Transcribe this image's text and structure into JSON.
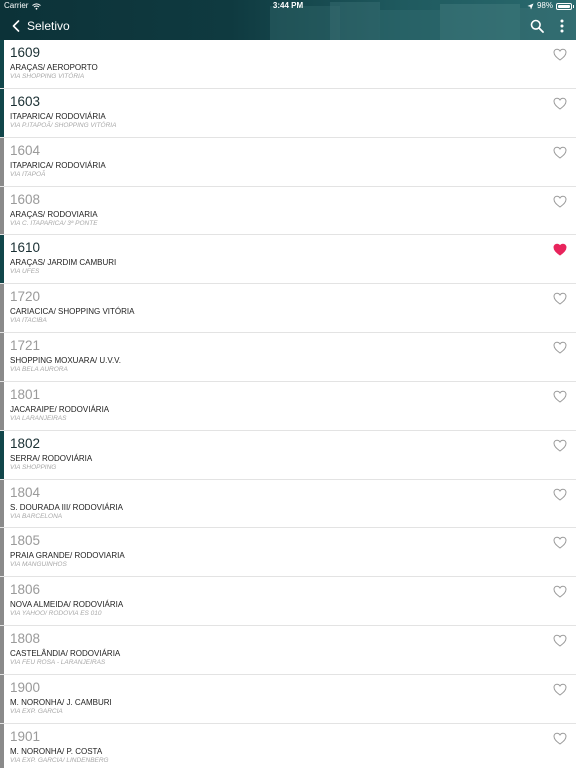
{
  "status_bar": {
    "carrier": "Carrier",
    "time": "3:44 PM",
    "battery": "98%",
    "battery_level": 0.98
  },
  "nav": {
    "title": "Seletivo"
  },
  "colors": {
    "header": "#0f3a40",
    "accent_bar_active": "#11464a",
    "accent_bar_inactive": "#8a8a8a",
    "favorite": "#e8245c",
    "icon_outline": "#9a9a9a"
  },
  "routes": [
    {
      "number": "1609",
      "name": "ARAÇAS/ AEROPORTO",
      "via": "VIA SHOPPING VITÓRIA",
      "active": true,
      "favorite": false
    },
    {
      "number": "1603",
      "name": "ITAPARICA/ RODOVIÁRIA",
      "via": "VIA P.ITAPOÃ/ SHOPPING VITÓRIA",
      "active": true,
      "favorite": false
    },
    {
      "number": "1604",
      "name": "ITAPARICA/ RODOVIÁRIA",
      "via": "VIA ITAPOÃ",
      "active": false,
      "favorite": false
    },
    {
      "number": "1608",
      "name": "ARAÇAS/ RODOVIARIA",
      "via": "VIA C. ITAPARICA/ 3ª PONTE",
      "active": false,
      "favorite": false
    },
    {
      "number": "1610",
      "name": "ARAÇAS/ JARDIM CAMBURI",
      "via": "VIA UFES",
      "active": true,
      "favorite": true
    },
    {
      "number": "1720",
      "name": "CARIACICA/ SHOPPING VITÓRIA",
      "via": "VIA ITACIBA",
      "active": false,
      "favorite": false
    },
    {
      "number": "1721",
      "name": "SHOPPING MOXUARA/ U.V.V.",
      "via": "VIA BELA AURORA",
      "active": false,
      "favorite": false
    },
    {
      "number": "1801",
      "name": "JACARAIPE/ RODOVIÁRIA",
      "via": "VIA LARANJEIRAS",
      "active": false,
      "favorite": false
    },
    {
      "number": "1802",
      "name": "SERRA/ RODOVIÁRIA",
      "via": "VIA SHOPPING",
      "active": true,
      "favorite": false
    },
    {
      "number": "1804",
      "name": "S. DOURADA III/ RODOVIÁRIA",
      "via": "VIA BARCELONA",
      "active": false,
      "favorite": false
    },
    {
      "number": "1805",
      "name": "PRAIA GRANDE/ RODOVIARIA",
      "via": "VIA MANGUINHOS",
      "active": false,
      "favorite": false
    },
    {
      "number": "1806",
      "name": "NOVA ALMEIDA/ RODOVIÁRIA",
      "via": "VIA YAHOO/ RODOVIA ES 010",
      "active": false,
      "favorite": false
    },
    {
      "number": "1808",
      "name": "CASTELÂNDIA/ RODOVIÁRIA",
      "via": "VIA FEU ROSA - LARANJEIRAS",
      "active": false,
      "favorite": false
    },
    {
      "number": "1900",
      "name": "M. NORONHA/ J. CAMBURI",
      "via": "VIA EXP. GARCIA",
      "active": false,
      "favorite": false
    },
    {
      "number": "1901",
      "name": "M. NORONHA/ P. COSTA",
      "via": "VIA EXP. GARCIA/ LINDENBERG",
      "active": false,
      "favorite": false
    }
  ]
}
